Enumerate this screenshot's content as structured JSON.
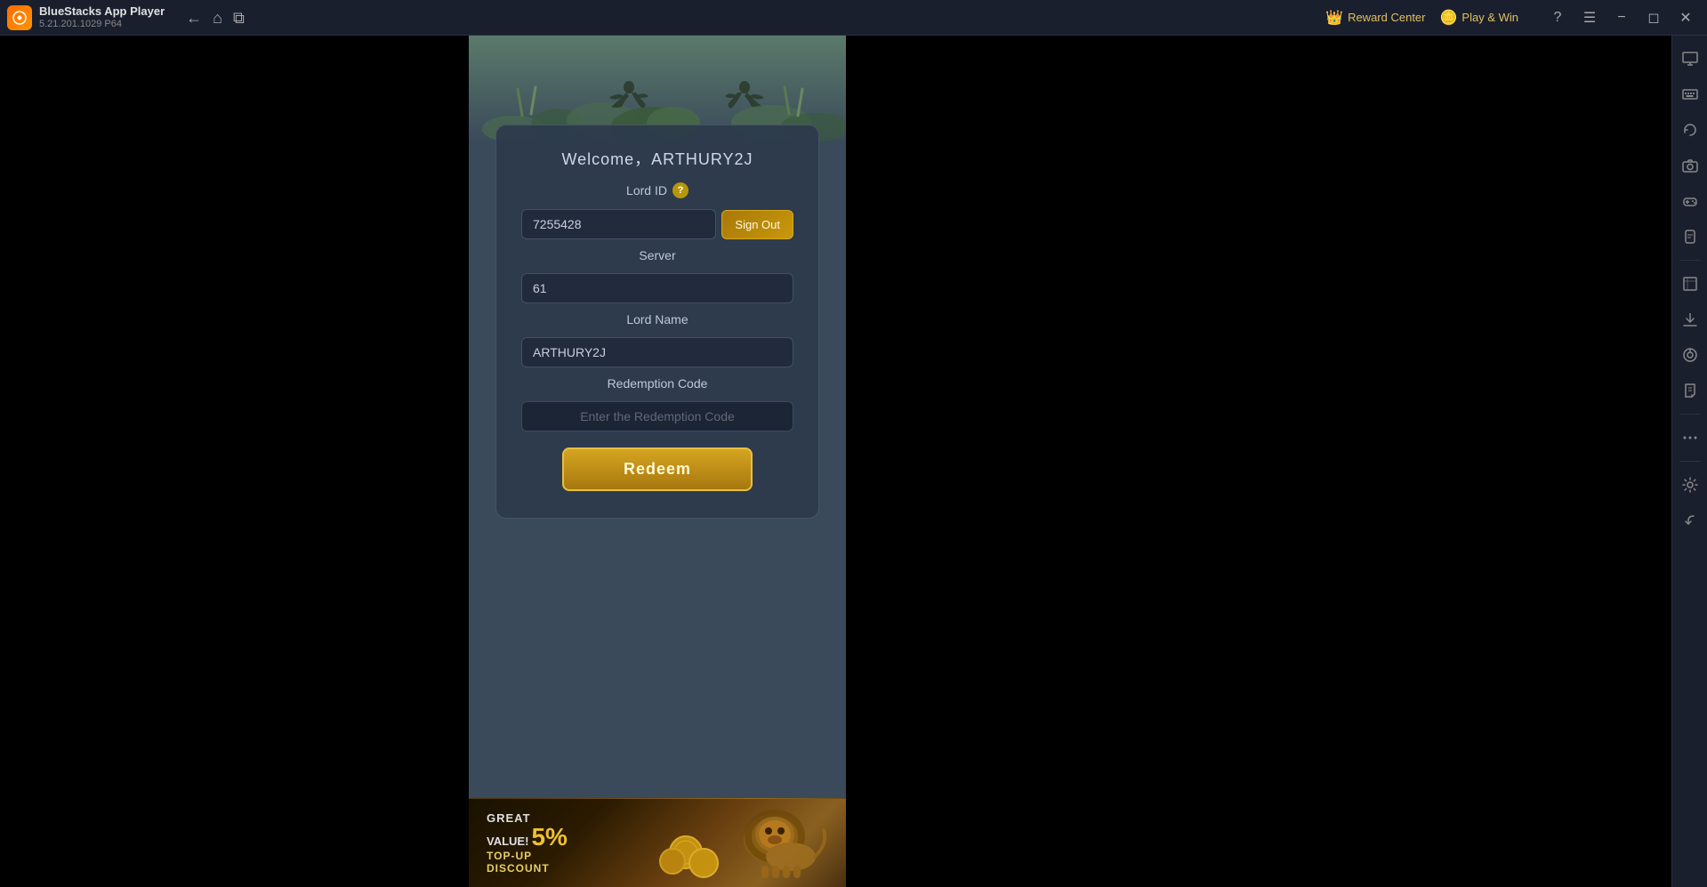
{
  "titleBar": {
    "appName": "BlueStacks App Player",
    "version": "5.21.201.1029  P64",
    "rewardCenter": "Reward Center",
    "playWin": "Play & Win"
  },
  "dialog": {
    "title": "Welcome，ARTHURY2J",
    "lordIdLabel": "Lord ID",
    "lordIdValue": "7255428",
    "signOutLabel": "Sign Out",
    "serverLabel": "Server",
    "serverValue": "61",
    "lordNameLabel": "Lord Name",
    "lordNameValue": "ARTHURY2J",
    "redemptionCodeLabel": "Redemption Code",
    "redemptionCodePlaceholder": "Enter the Redemption Code",
    "redeemLabel": "Redeem"
  },
  "banner": {
    "greatValue": "GREAT",
    "percent": "5%",
    "topUp": "TOP-UP",
    "discount": "DISCOUNT"
  },
  "sidebar": {
    "icons": [
      {
        "name": "settings-icon",
        "glyph": "⚙"
      },
      {
        "name": "screen-icon",
        "glyph": "🖥"
      },
      {
        "name": "rotate-icon",
        "glyph": "↺"
      },
      {
        "name": "camera-icon",
        "glyph": "📷"
      },
      {
        "name": "gamepad-icon",
        "glyph": "🎮"
      },
      {
        "name": "apk-icon",
        "glyph": "📦"
      },
      {
        "name": "resize-icon",
        "glyph": "⊞"
      },
      {
        "name": "download-icon",
        "glyph": "⬇"
      },
      {
        "name": "macro-icon",
        "glyph": "◎"
      },
      {
        "name": "script-icon",
        "glyph": "✏"
      },
      {
        "name": "more-icon",
        "glyph": "⋯"
      },
      {
        "name": "settings2-icon",
        "glyph": "⚙"
      },
      {
        "name": "back-icon",
        "glyph": "↩"
      }
    ]
  }
}
